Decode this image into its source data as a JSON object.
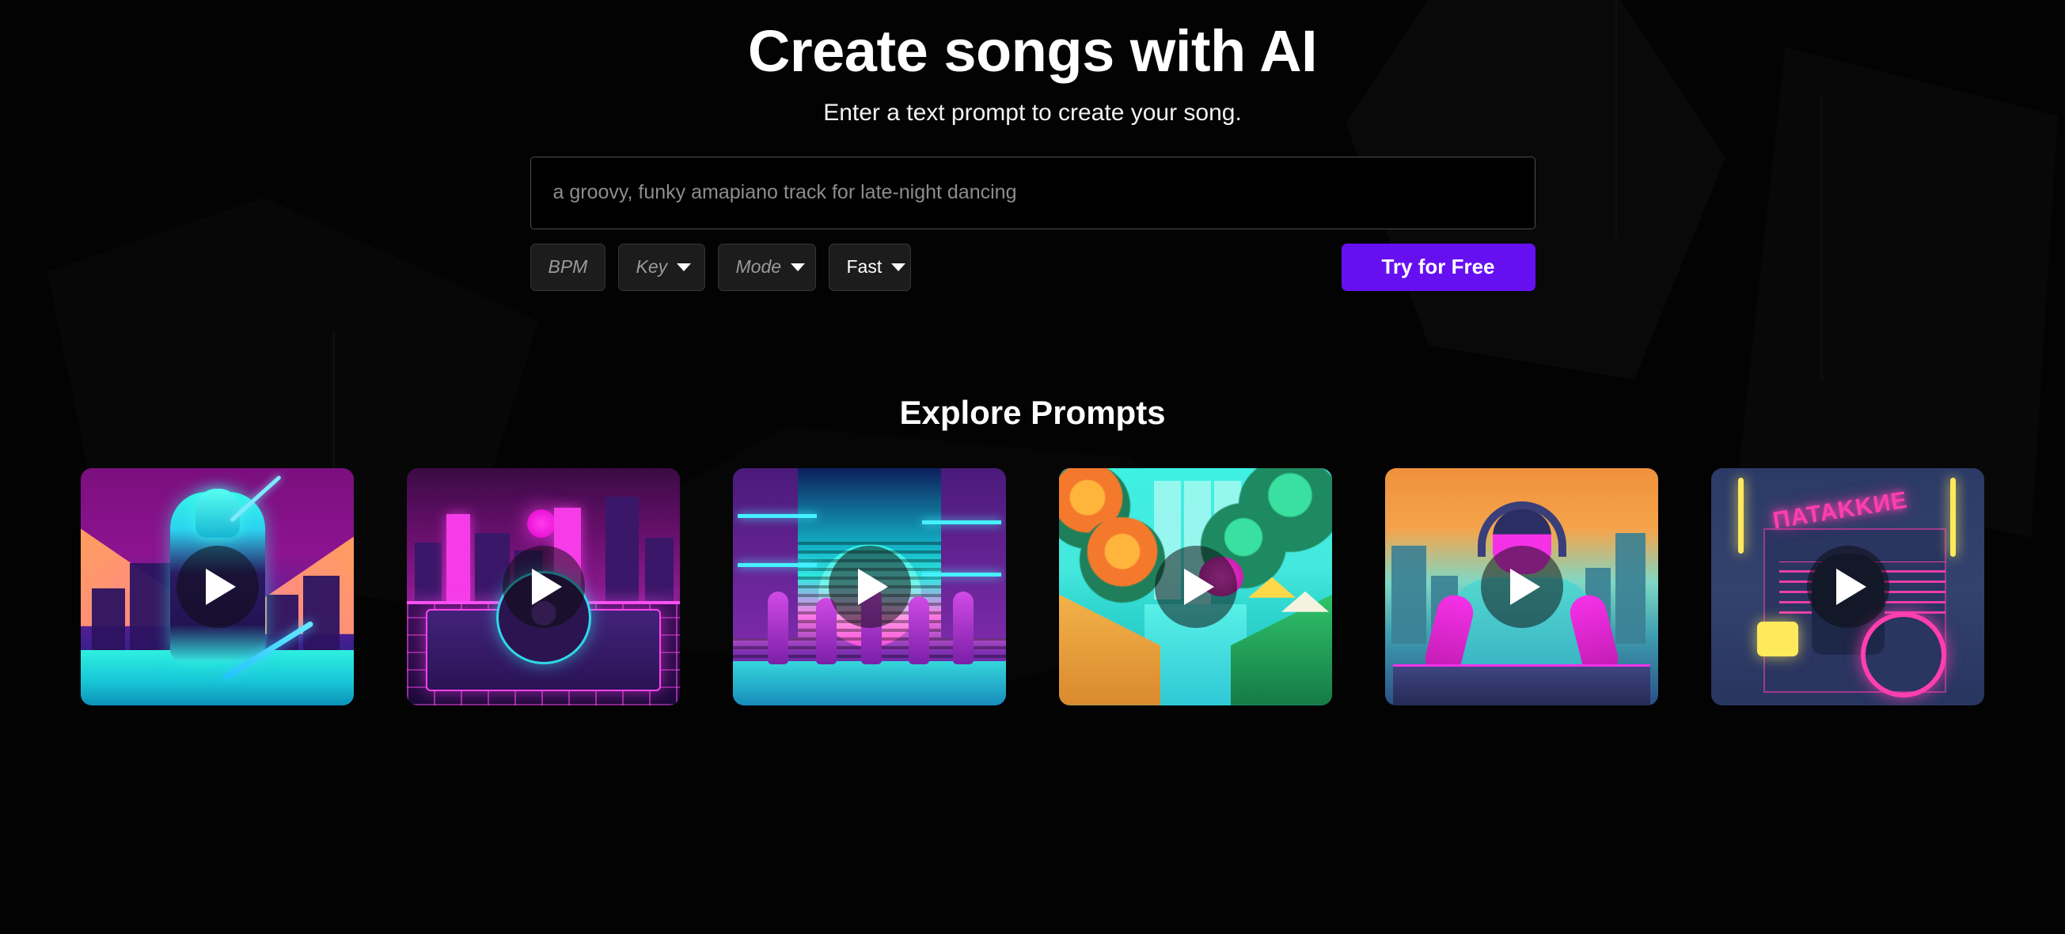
{
  "hero": {
    "title": "Create songs with AI",
    "subtitle": "Enter a text prompt to create your song."
  },
  "composer": {
    "prompt_placeholder": "a groovy, funky amapiano track for late-night dancing",
    "prompt_value": "",
    "bpm_placeholder": "BPM",
    "bpm_value": "",
    "key_label": "Key",
    "mode_label": "Mode",
    "speed_label": "Fast",
    "cta_label": "Try for Free"
  },
  "explore": {
    "title": "Explore Prompts",
    "cards": [
      {
        "name": "neon-samurai",
        "caption": ""
      },
      {
        "name": "synthwave-turntable",
        "caption": ""
      },
      {
        "name": "neon-street-dancers",
        "caption": ""
      },
      {
        "name": "tropical-canal",
        "caption": ""
      },
      {
        "name": "dj-at-mixer",
        "caption": ""
      },
      {
        "name": "neon-storefront",
        "caption": "ΠATAKKИЕ"
      }
    ]
  },
  "colors": {
    "page_background": "#030303",
    "accent_purple": "#6610f2",
    "text_primary": "#ffffff",
    "text_placeholder": "#8d8d8d",
    "field_background": "#1c1c1c",
    "field_border": "#343434",
    "input_border": "#4d4d4d"
  }
}
